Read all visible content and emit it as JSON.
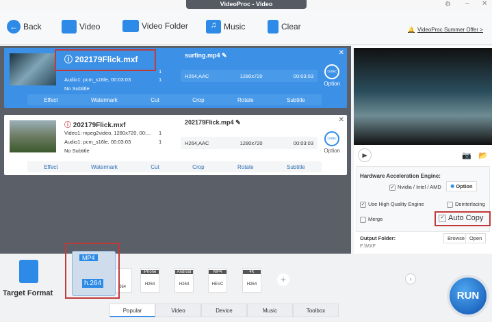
{
  "window": {
    "title": "VideoProc - Video"
  },
  "toolbar": {
    "back": "Back",
    "video": "Video",
    "video_folder": "Video Folder",
    "music": "Music",
    "clear": "Clear",
    "offer": "VideoProc Summer Offer >"
  },
  "cards": [
    {
      "source": "202179Flick.mxf",
      "audio": "Audio1: pcm_s16le, 00:03:03",
      "subtitle": "No Subtitle",
      "output": "surfing.mp4",
      "codec": "H264,AAC",
      "resolution": "1280x720",
      "duration": "00:03:03",
      "option": "Option",
      "codec_icon": "codec"
    },
    {
      "source": "202179Flick.mxf",
      "video": "Video1: mpeg2video, 1280x720, 00:...",
      "audio": "Audio1: pcm_s16le, 00:03:03",
      "subtitle": "No Subtitle",
      "output": "202179Flick.mp4",
      "codec": "H264,AAC",
      "resolution": "1280x720",
      "duration": "00:03:03",
      "option": "Option",
      "codec_icon": "codec"
    }
  ],
  "edit_tools": [
    "Effect",
    "Watermark",
    "Cut",
    "Crop",
    "Rotate",
    "Subtitle"
  ],
  "track_count": "1",
  "settings": {
    "hw_title": "Hardware Acceleration Engine:",
    "hw_vendor": "Nvidia / Intel / AMD",
    "option": "Option",
    "high_quality": "Use High Quality Engine",
    "deinterlacing": "Deinterlacing",
    "merge": "Merge",
    "auto_copy": "Auto Copy",
    "output_folder_label": "Output Folder:",
    "output_folder": "F:\\MXF",
    "browse": "Browse",
    "open": "Open"
  },
  "formats": {
    "target_label": "Target Format",
    "selected_top": "MP4",
    "selected_bottom": "h.264",
    "items": [
      {
        "tag": "iPhone",
        "codec": "H264"
      },
      {
        "tag": "Android",
        "codec": "H264"
      },
      {
        "tag": "MP4",
        "codec": "HEVC"
      },
      {
        "tag": "4K",
        "codec": "H264"
      }
    ],
    "hidden_codec": "264"
  },
  "tabs": [
    "Popular",
    "Video",
    "Device",
    "Music",
    "Toolbox"
  ],
  "run": "RUN"
}
